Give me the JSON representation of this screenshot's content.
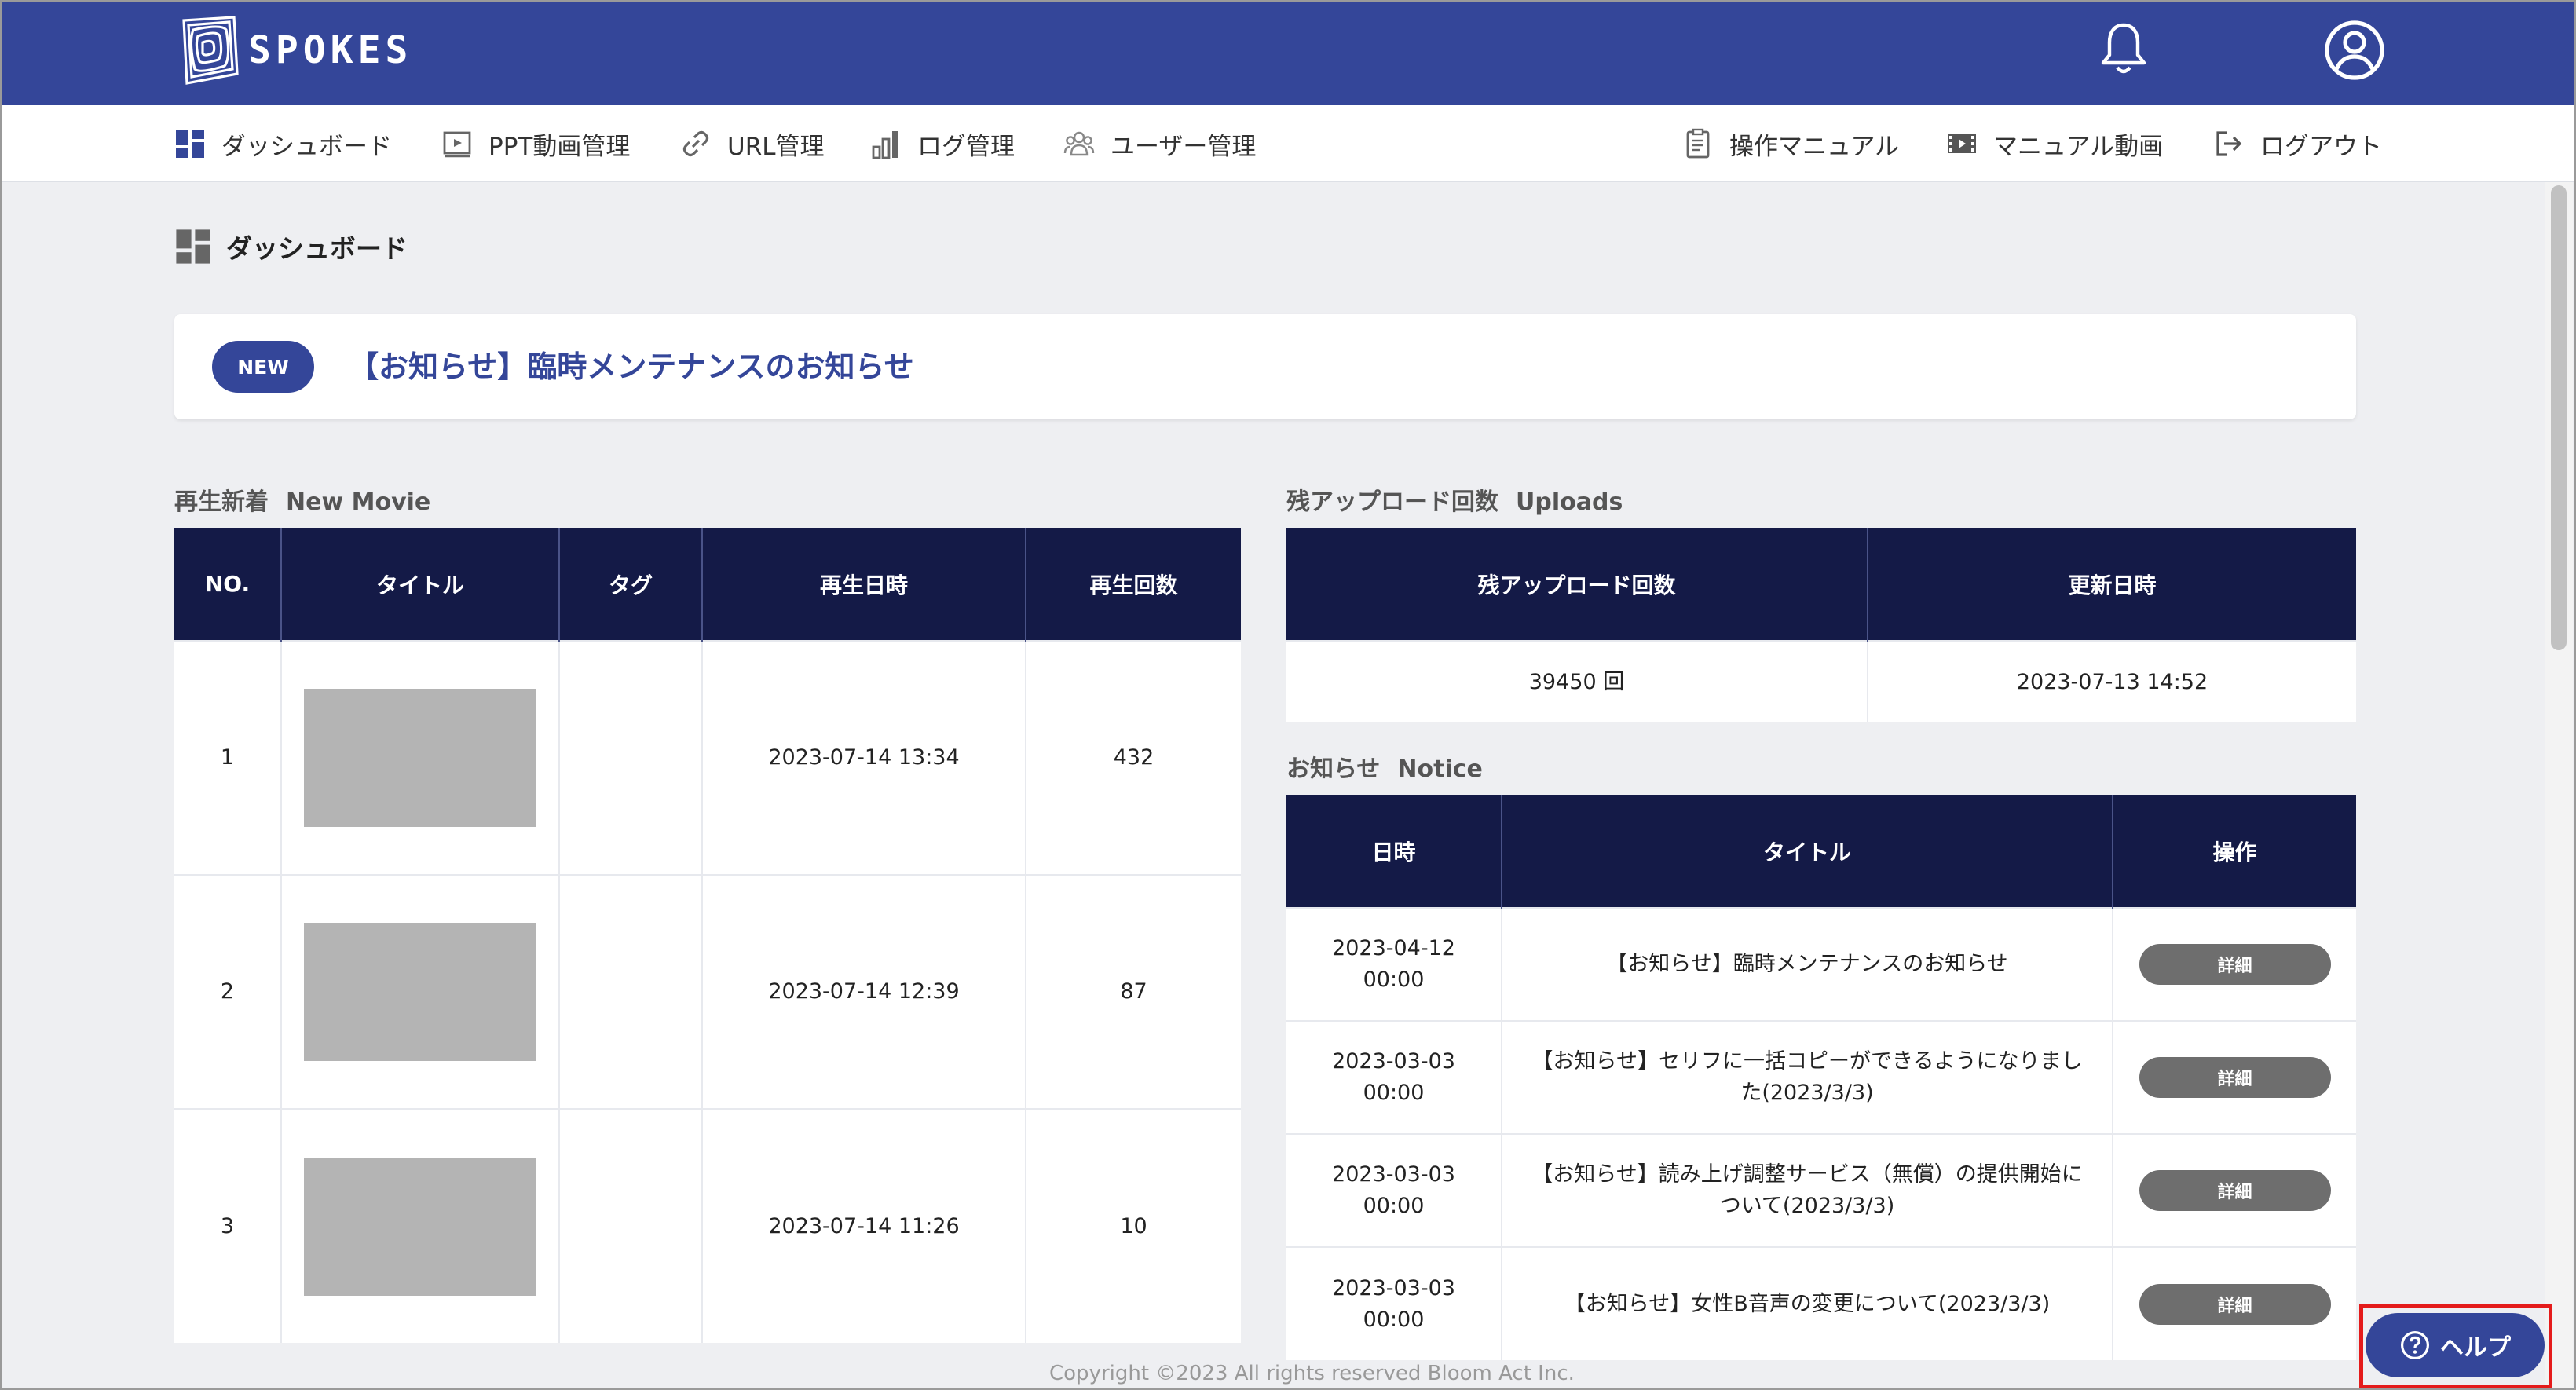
{
  "header": {
    "brand": "SPOKES",
    "bell_icon": "bell-icon",
    "user_icon": "user-account-icon",
    "bg_color": "#344699"
  },
  "nav": {
    "items": [
      {
        "label": "ダッシュボード",
        "icon": "dashboard-icon"
      },
      {
        "label": "PPT動画管理",
        "icon": "presentation-icon"
      },
      {
        "label": "URL管理",
        "icon": "link-icon"
      },
      {
        "label": "ログ管理",
        "icon": "log-chart-icon"
      },
      {
        "label": "ユーザー管理",
        "icon": "users-icon"
      },
      {
        "label": "操作マニュアル",
        "icon": "manual-document-icon"
      },
      {
        "label": "マニュアル動画",
        "icon": "video-icon"
      },
      {
        "label": "ログアウト",
        "icon": "logout-icon"
      }
    ]
  },
  "page": {
    "title": "ダッシュボード",
    "banner": {
      "badge": "NEW",
      "text": "【お知らせ】臨時メンテナンスのお知らせ"
    }
  },
  "new_movie": {
    "label_ja": "再生新着",
    "label_en": "New Movie",
    "columns": [
      "NO.",
      "タイトル",
      "タグ",
      "再生日時",
      "再生回数"
    ],
    "rows": [
      {
        "no": "1",
        "tag": "",
        "datetime": "2023-07-14 13:34",
        "count": "432"
      },
      {
        "no": "2",
        "tag": "",
        "datetime": "2023-07-14 12:39",
        "count": "87"
      },
      {
        "no": "3",
        "tag": "",
        "datetime": "2023-07-14 11:26",
        "count": "10"
      }
    ]
  },
  "uploads": {
    "label_ja": "残アップロード回数",
    "label_en": "Uploads",
    "columns": [
      "残アップロード回数",
      "更新日時"
    ],
    "row": {
      "remaining": "39450 回",
      "updated": "2023-07-13 14:52"
    }
  },
  "notice": {
    "label_ja": "お知らせ",
    "label_en": "Notice",
    "columns": [
      "日時",
      "タイトル",
      "操作"
    ],
    "rows": [
      {
        "date": "2023-04-12",
        "time": "00:00",
        "title": "【お知らせ】臨時メンテナンスのお知らせ",
        "action": "詳細"
      },
      {
        "date": "2023-03-03",
        "time": "00:00",
        "title": "【お知らせ】セリフに一括コピーができるようになりました(2023/3/3)",
        "action": "詳細"
      },
      {
        "date": "2023-03-03",
        "time": "00:00",
        "title": "【お知らせ】読み上げ調整サービス（無償）の提供開始について(2023/3/3)",
        "action": "詳細"
      },
      {
        "date": "2023-03-03",
        "time": "00:00",
        "title": "【お知らせ】女性B音声の変更について(2023/3/3)",
        "action": "詳細"
      }
    ]
  },
  "footer": {
    "copyright": "Copyright ©2023 All rights reserved Bloom Act Inc."
  },
  "help": {
    "label": "ヘルプ",
    "icon": "question-circle-icon",
    "highlight_color": "#e41b1b"
  }
}
